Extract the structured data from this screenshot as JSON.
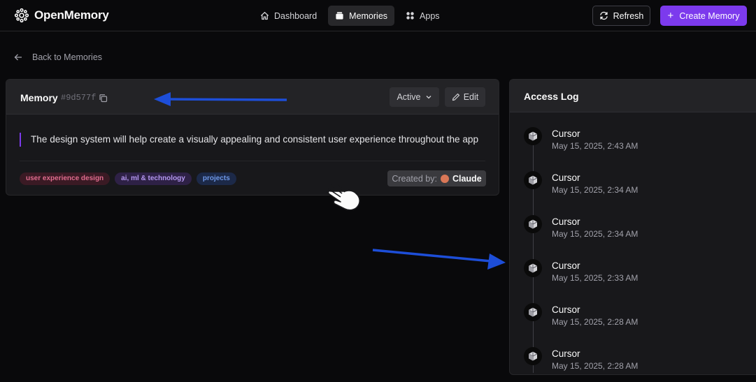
{
  "app": {
    "name": "OpenMemory"
  },
  "nav": {
    "items": [
      {
        "label": "Dashboard",
        "icon": "home-icon",
        "active": false
      },
      {
        "label": "Memories",
        "icon": "memories-icon",
        "active": true
      },
      {
        "label": "Apps",
        "icon": "apps-icon",
        "active": false
      }
    ],
    "refresh_label": "Refresh",
    "create_label": "Create Memory"
  },
  "back_label": "Back to Memories",
  "memory": {
    "title": "Memory",
    "id": "#9d577f",
    "status": "Active",
    "edit_label": "Edit",
    "content": "The design system will help create a visually appealing and consistent user experience throughout the app",
    "tags": [
      "user experience design",
      "ai, ml & technology",
      "projects"
    ],
    "created_by_label": "Created by:",
    "created_by": "Claude"
  },
  "access_log": {
    "title": "Access Log",
    "entries": [
      {
        "app": "Cursor",
        "time": "May 15, 2025, 2:43 AM"
      },
      {
        "app": "Cursor",
        "time": "May 15, 2025, 2:34 AM"
      },
      {
        "app": "Cursor",
        "time": "May 15, 2025, 2:34 AM"
      },
      {
        "app": "Cursor",
        "time": "May 15, 2025, 2:33 AM"
      },
      {
        "app": "Cursor",
        "time": "May 15, 2025, 2:28 AM"
      },
      {
        "app": "Cursor",
        "time": "May 15, 2025, 2:28 AM"
      }
    ]
  },
  "colors": {
    "accent": "#7c3aed",
    "annotation_arrow": "#1d4ed8",
    "claude": "#d97757"
  }
}
